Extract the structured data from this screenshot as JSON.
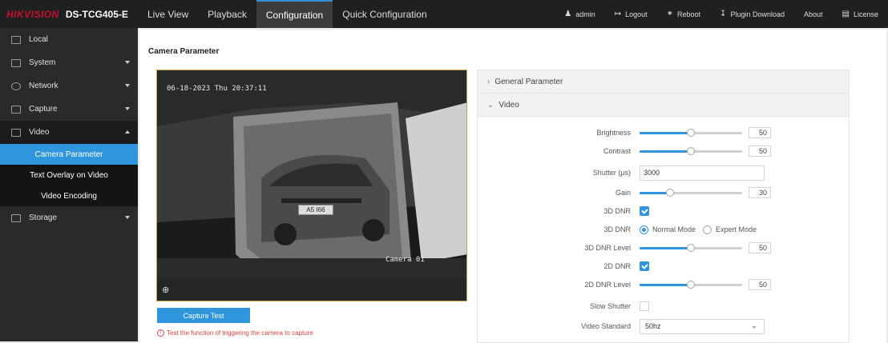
{
  "brand": {
    "logo": "HIKVISION",
    "model": "DS-TCG405-E",
    "logo_color": "#c8102e"
  },
  "topnav": [
    {
      "label": "Live View",
      "active": false
    },
    {
      "label": "Playback",
      "active": false
    },
    {
      "label": "Configuration",
      "active": true
    },
    {
      "label": "Quick Configuration",
      "active": false
    }
  ],
  "toolbar": {
    "user": "admin",
    "logout": "Logout",
    "reboot": "Reboot",
    "plugin": "Plugin Download",
    "about": "About",
    "license": "License"
  },
  "sidebar": {
    "items": [
      {
        "label": "Local",
        "icon": "monitor-icon"
      },
      {
        "label": "System",
        "icon": "system-icon"
      },
      {
        "label": "Network",
        "icon": "globe-icon"
      },
      {
        "label": "Capture",
        "icon": "capture-icon"
      },
      {
        "label": "Video",
        "icon": "video-icon"
      },
      {
        "label": "Storage",
        "icon": "storage-icon"
      }
    ],
    "video_sub": [
      {
        "label": "Camera Parameter",
        "active": true
      },
      {
        "label": "Text Overlay on Video",
        "active": false
      },
      {
        "label": "Video Encoding",
        "active": false
      }
    ]
  },
  "main": {
    "title": "Camera Parameter",
    "osd_time": "06-18-2023 Thu 20:37:11",
    "osd_camera": "Camera 01",
    "plate": "A5 I66",
    "capture_button": "Capture Test",
    "hint": "Test the function of triggering the camera to capture"
  },
  "panel": {
    "general": "General Parameter",
    "video": "Video",
    "brightness": {
      "label": "Brightness",
      "value": "50",
      "level": 0.5
    },
    "contrast": {
      "label": "Contrast",
      "value": "50",
      "level": 0.5
    },
    "shutter": {
      "label": "Shutter (μs)",
      "value": "3000"
    },
    "gain": {
      "label": "Gain",
      "value": "30",
      "level": 0.3
    },
    "dnr3d_enable": {
      "label": "3D DNR",
      "checked": true
    },
    "dnr3d_mode": {
      "label": "3D DNR",
      "normal": "Normal Mode",
      "expert": "Expert Mode",
      "selected": "normal"
    },
    "dnr3d_level": {
      "label": "3D DNR Level",
      "value": "50",
      "level": 0.5
    },
    "dnr2d_enable": {
      "label": "2D DNR",
      "checked": true
    },
    "dnr2d_level": {
      "label": "2D DNR Level",
      "value": "50",
      "level": 0.5
    },
    "slow_shutter": {
      "label": "Slow Shutter",
      "checked": false
    },
    "video_standard": {
      "label": "Video Standard",
      "value": "50hz"
    }
  },
  "colors": {
    "accent": "#2f95dd",
    "topbar": "#202020",
    "sidebar": "#2a2a2a",
    "warning": "#e04343"
  }
}
